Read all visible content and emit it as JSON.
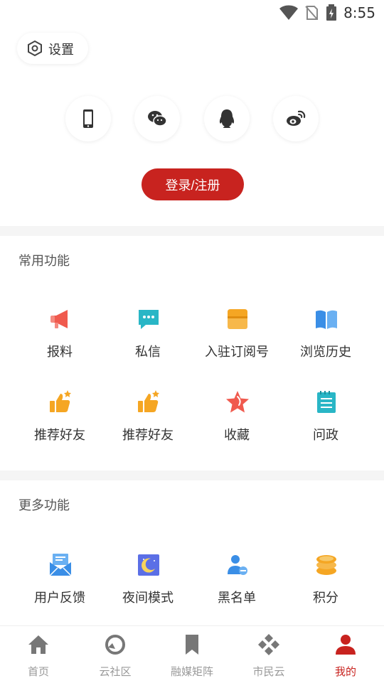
{
  "status_bar": {
    "time": "8:55"
  },
  "settings": {
    "label": "设置"
  },
  "social": [
    "phone-icon",
    "wechat-icon",
    "qq-icon",
    "weibo-icon"
  ],
  "login_button": {
    "label": "登录/注册"
  },
  "common_functions": {
    "title": "常用功能",
    "items": [
      {
        "label": "报料",
        "icon": "megaphone-icon"
      },
      {
        "label": "私信",
        "icon": "message-icon"
      },
      {
        "label": "入驻订阅号",
        "icon": "store-icon"
      },
      {
        "label": "浏览历史",
        "icon": "book-icon"
      },
      {
        "label": "推荐好友",
        "icon": "thumbs-up-icon"
      },
      {
        "label": "推荐好友",
        "icon": "thumbs-up-icon"
      },
      {
        "label": "收藏",
        "icon": "star-icon"
      },
      {
        "label": "问政",
        "icon": "notepad-icon"
      }
    ]
  },
  "more_functions": {
    "title": "更多功能",
    "items": [
      {
        "label": "用户反馈",
        "icon": "mail-icon"
      },
      {
        "label": "夜间模式",
        "icon": "moon-icon"
      },
      {
        "label": "黑名单",
        "icon": "user-block-icon"
      },
      {
        "label": "积分",
        "icon": "coins-icon"
      }
    ]
  },
  "bottom_nav": [
    {
      "label": "首页",
      "icon": "home-icon"
    },
    {
      "label": "云社区",
      "icon": "community-icon"
    },
    {
      "label": "融媒矩阵",
      "icon": "bookmark-icon"
    },
    {
      "label": "市民云",
      "icon": "diamond-grid-icon"
    },
    {
      "label": "我的",
      "icon": "user-icon",
      "active": true
    }
  ],
  "colors": {
    "accent": "#c8231f",
    "orange": "#f5a623",
    "cyan": "#29b6c6",
    "blue": "#3a8ee6"
  }
}
